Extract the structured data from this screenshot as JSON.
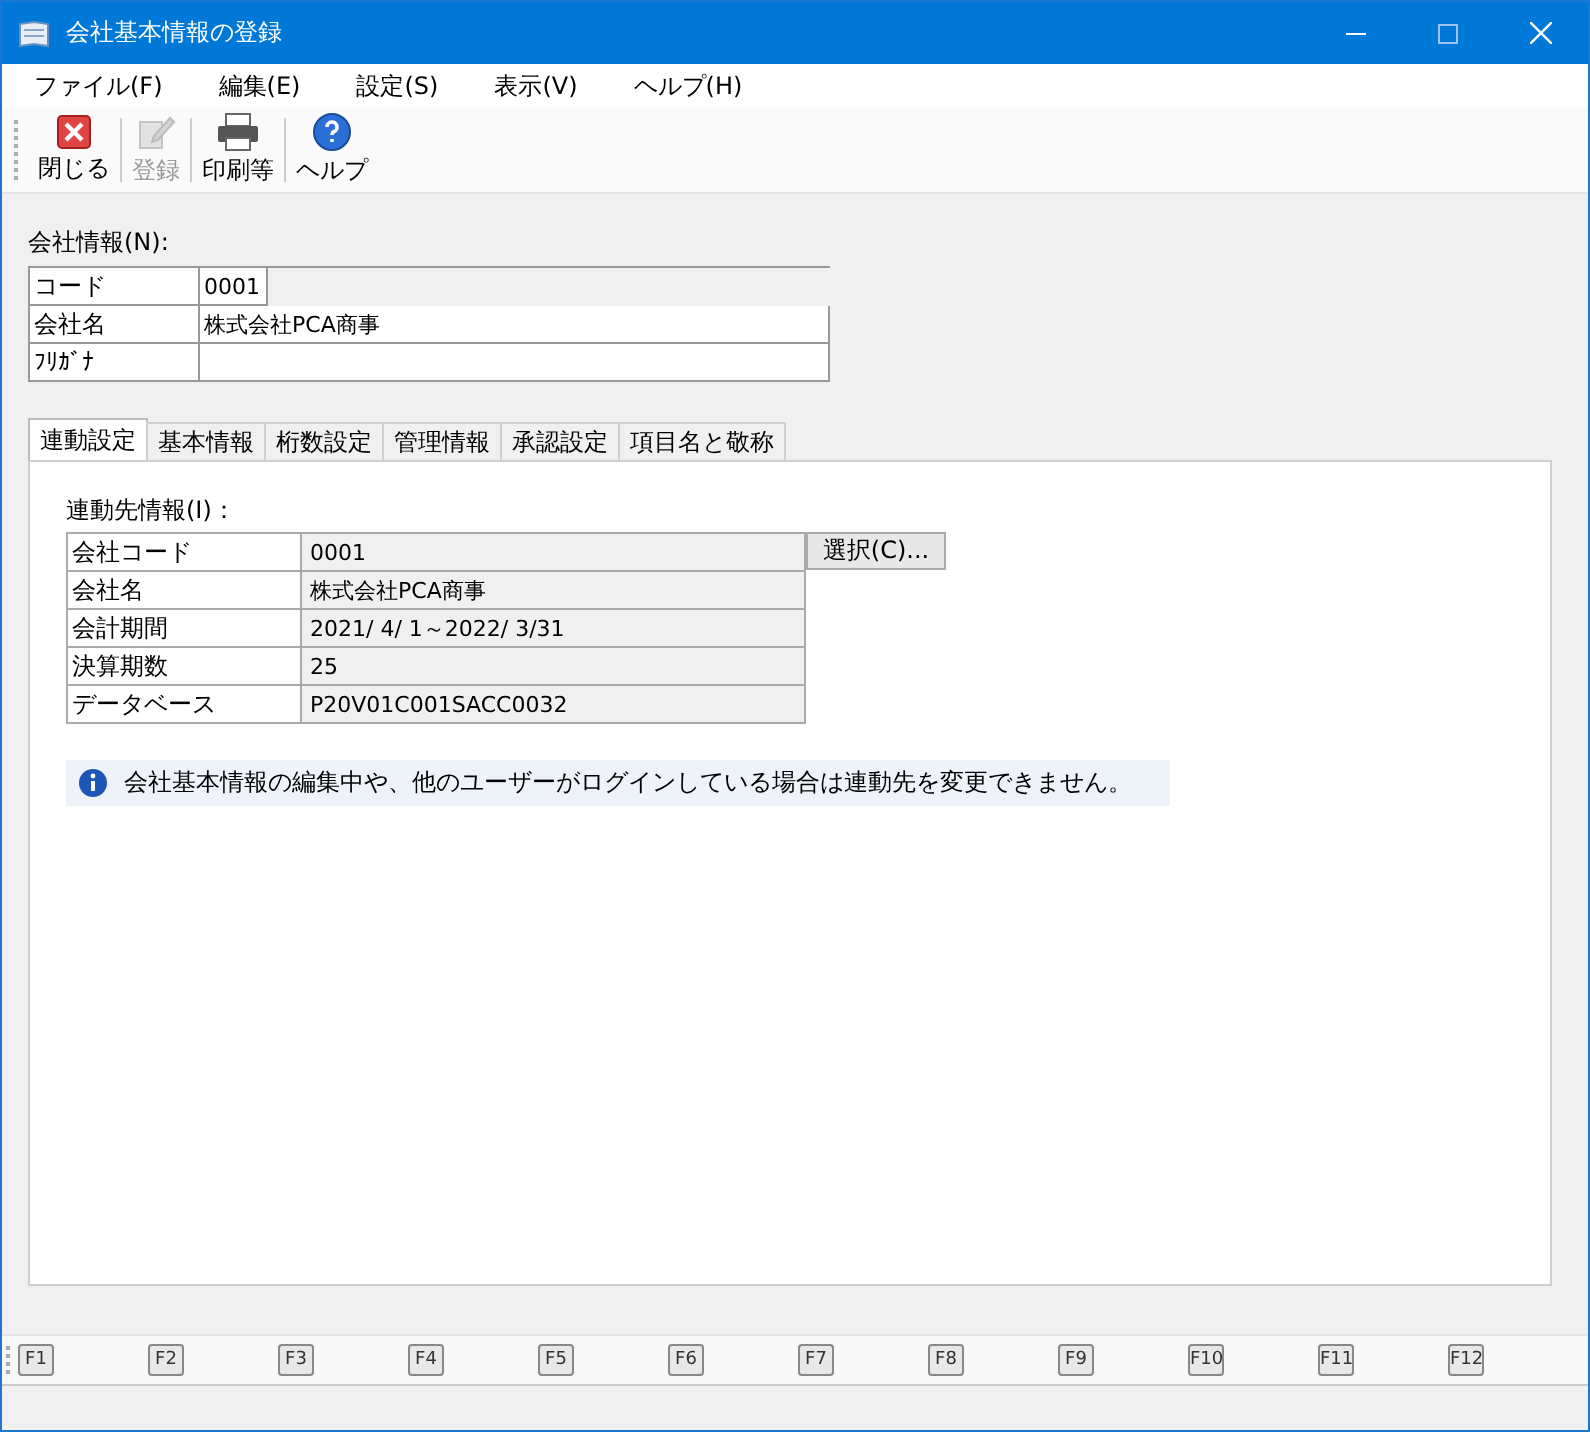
{
  "window": {
    "title": "会社基本情報の登録"
  },
  "menu": [
    "ファイル(F)",
    "編集(E)",
    "設定(S)",
    "表示(V)",
    "ヘルプ(H)"
  ],
  "toolbar": [
    {
      "kind": "close",
      "label": "閉じる",
      "disabled": false
    },
    {
      "kind": "register",
      "label": "登録",
      "disabled": true
    },
    {
      "kind": "print",
      "label": "印刷等",
      "disabled": false
    },
    {
      "kind": "help",
      "label": "ヘルプ",
      "disabled": false
    }
  ],
  "company": {
    "heading": "会社情報(N):",
    "fields": [
      {
        "label": "コード",
        "value": "0001",
        "kind": "short"
      },
      {
        "label": "会社名",
        "value": "株式会社PCA商事",
        "kind": "long"
      },
      {
        "label": "ﾌﾘｶﾞﾅ",
        "kind": "long"
      }
    ]
  },
  "tabs": [
    {
      "label": "連動設定",
      "selected": true
    },
    {
      "label": "基本情報",
      "selected": false
    },
    {
      "label": "桁数設定",
      "selected": false
    },
    {
      "label": "管理情報",
      "selected": false
    },
    {
      "label": "承認設定",
      "selected": false
    },
    {
      "label": "項目名と敬称",
      "selected": false
    }
  ],
  "link": {
    "heading": "連動先情報(I)：",
    "rows": [
      {
        "label": "会社コード",
        "value": "0001"
      },
      {
        "label": "会社名",
        "value": "株式会社PCA商事"
      },
      {
        "label": "会計期間",
        "value": "2021/ 4/ 1～2022/ 3/31"
      },
      {
        "label": "決算期数",
        "value": "25"
      },
      {
        "label": "データベース",
        "value": "P20V01C001SACC0032"
      }
    ],
    "button": "選択(C)..."
  },
  "info": "会社基本情報の編集中や、他のユーザーがログインしている場合は連動先を変更できません。",
  "fkeys": [
    "F1",
    "F2",
    "F3",
    "F4",
    "F5",
    "F6",
    "F7",
    "F8",
    "F9",
    "F10",
    "F11",
    "F12"
  ]
}
